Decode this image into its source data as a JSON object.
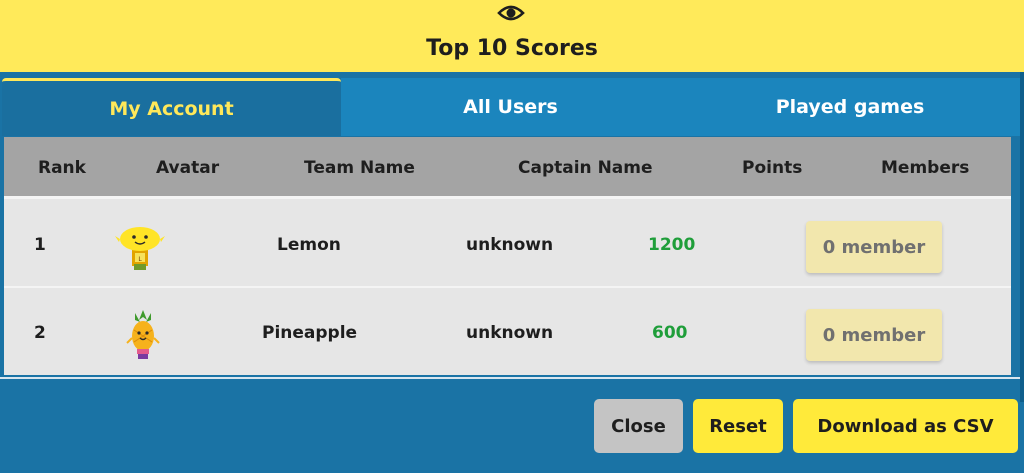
{
  "header": {
    "icon": "eye-icon",
    "title": "Top 10 Scores",
    "background": "#ffea5a"
  },
  "tabs": [
    {
      "label": "My Account",
      "active": true
    },
    {
      "label": "All Users",
      "active": false
    },
    {
      "label": "Played games",
      "active": false
    }
  ],
  "table": {
    "columns": [
      "Rank",
      "Avatar",
      "Team Name",
      "Captain Name",
      "Points",
      "Members"
    ],
    "rows": [
      {
        "rank": "1",
        "avatar": "lemon-avatar",
        "team": "Lemon",
        "captain": "unknown",
        "points": "1200",
        "members": "0 member"
      },
      {
        "rank": "2",
        "avatar": "pineapple-avatar",
        "team": "Pineapple",
        "captain": "unknown",
        "points": "600",
        "members": "0 member"
      }
    ]
  },
  "footer": {
    "close_label": "Close",
    "reset_label": "Reset",
    "download_label": "Download as CSV"
  },
  "colors": {
    "accent_yellow": "#ffea3a",
    "panel_blue": "#1a73a5",
    "points_green": "#1f9e3a"
  }
}
